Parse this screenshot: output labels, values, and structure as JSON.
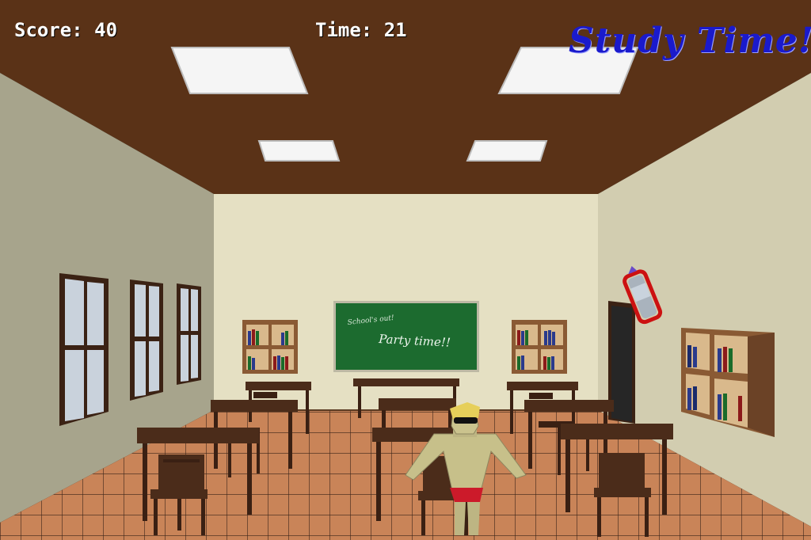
{
  "hud": {
    "score_label": "Score:",
    "score_value": "40",
    "time_label": "Time:",
    "time_value": "21"
  },
  "mode_title": "Study Time!",
  "chalkboard": {
    "line1": "School's out!",
    "line2": "Party time!!"
  },
  "colors": {
    "ceiling": "#5a3217",
    "left_wall": "#a7a48c",
    "back_wall": "#e5e0c3",
    "right_wall": "#d2cdb0",
    "floor": "#c98458",
    "floor_grid": "#3a2418",
    "chalkboard": "#1c6b2f",
    "desk": "#4b2c1a",
    "title_blue": "#1a1acc",
    "pickup_outline": "#cc1111"
  },
  "sprites": {
    "player": "muscle-man-with-sunglasses",
    "pickup": "energy-drink-can-icon"
  }
}
